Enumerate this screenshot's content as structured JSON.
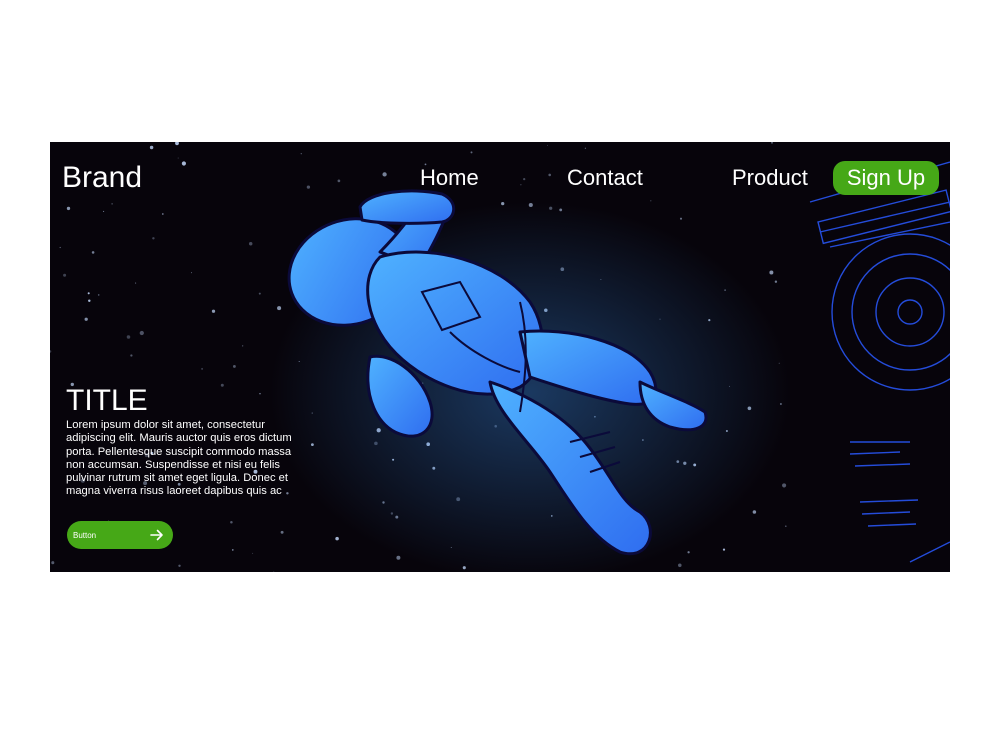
{
  "nav": {
    "brand": "Brand",
    "links": [
      {
        "label": "Home"
      },
      {
        "label": "Contact"
      },
      {
        "label": "Product"
      }
    ],
    "signup_label": "Sign Up"
  },
  "hero": {
    "title": "TITLE",
    "body": "Lorem ipsum dolor sit amet, consectetur adipiscing elit. Mauris auctor quis eros dictum porta. Pellentesque suscipit commodo massa non accumsan. Suspendisse et nisi eu felis pulvinar rutrum sit amet eget ligula. Donec et magna viverra risus laoreet dapibus quis ac",
    "button_label": "Button",
    "button_icon": "arrow-right-icon",
    "background_image": "astronaut-illustration"
  },
  "colors": {
    "accent": "#46a817",
    "hero_background": "#07040b",
    "illustration_blue": "#2e8cff",
    "text": "#ffffff"
  }
}
